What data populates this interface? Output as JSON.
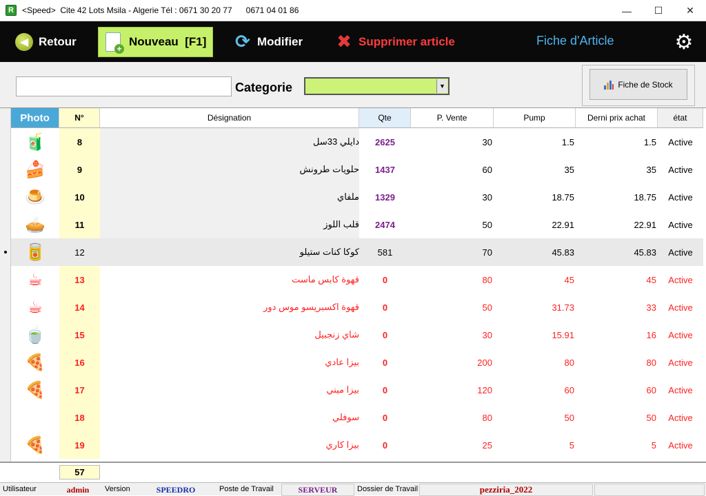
{
  "window": {
    "title": "<Speed>  Cite 42 Lots Msila - Algerie Tél : 0671 30 20 77      0671 04 01 86",
    "minimize": "—",
    "maximize": "☐",
    "close": "✕"
  },
  "toolbar": {
    "retour_label": "Retour",
    "nouveau_label": "Nouveau  [F1]",
    "modifier_label": "Modifier",
    "supprimer_label": "Supprimer article",
    "fiche_title": "Fiche d'Article",
    "colors": {
      "background": "#0a0a0a",
      "nouveau_bg": "#c6f06a",
      "fiche_title": "#4fb3ee",
      "supprimer": "#ff3c3c"
    }
  },
  "filter": {
    "search_value": "",
    "categorie_label": "Categorie",
    "categorie_value": "",
    "fiche_stock_label": "Fiche de Stock"
  },
  "grid": {
    "columns": [
      "Photo",
      "N°",
      "Désignation",
      "Qte",
      "P. Vente",
      "Pump",
      "Derni prix achat",
      "état"
    ],
    "rows": [
      {
        "photo": "juice-box-icon",
        "num": "8",
        "designation": "دايلي 33سل",
        "qte": "2625",
        "vente": "30",
        "pump": "1.5",
        "achat": "1.5",
        "etat": "Active"
      },
      {
        "photo": "cake-slice-icon",
        "num": "9",
        "designation": "حلويات طرونش",
        "qte": "1437",
        "vente": "60",
        "pump": "35",
        "achat": "35",
        "etat": "Active"
      },
      {
        "photo": "mille-feuille-icon",
        "num": "10",
        "designation": "ملفاي",
        "qte": "1329",
        "vente": "30",
        "pump": "18.75",
        "achat": "18.75",
        "etat": "Active"
      },
      {
        "photo": "almond-cake-icon",
        "num": "11",
        "designation": "قلب اللوز",
        "qte": "2474",
        "vente": "50",
        "pump": "22.91",
        "achat": "22.91",
        "etat": "Active"
      },
      {
        "photo": "cola-can-icon",
        "num": "12",
        "designation": "كوكا كنات ستيلو",
        "qte": "581",
        "vente": "70",
        "pump": "45.83",
        "achat": "45.83",
        "etat": "Active"
      },
      {
        "photo": "coffee-cup-icon",
        "num": "13",
        "designation": "قهوة كابس ماست",
        "qte": "0",
        "vente": "80",
        "pump": "45",
        "achat": "45",
        "etat": "Active"
      },
      {
        "photo": "espresso-cup-icon",
        "num": "14",
        "designation": "قهوة اكسبريسو موس دور",
        "qte": "0",
        "vente": "50",
        "pump": "31.73",
        "achat": "33",
        "etat": "Active"
      },
      {
        "photo": "tea-glass-icon",
        "num": "15",
        "designation": "شاي زنجبيل",
        "qte": "0",
        "vente": "30",
        "pump": "15.91",
        "achat": "16",
        "etat": "Active"
      },
      {
        "photo": "pizza-icon",
        "num": "16",
        "designation": "بيزا عادي",
        "qte": "0",
        "vente": "200",
        "pump": "80",
        "achat": "80",
        "etat": "Active"
      },
      {
        "photo": "pizza-icon",
        "num": "17",
        "designation": "بيزا ميني",
        "qte": "0",
        "vente": "120",
        "pump": "60",
        "achat": "60",
        "etat": "Active"
      },
      {
        "photo": "",
        "num": "18",
        "designation": "سوفلي",
        "qte": "0",
        "vente": "80",
        "pump": "50",
        "achat": "50",
        "etat": "Active"
      },
      {
        "photo": "pizza-slice-icon",
        "num": "19",
        "designation": "بيزا كاري",
        "qte": "0",
        "vente": "25",
        "pump": "5",
        "achat": "5",
        "etat": "Active"
      }
    ],
    "selected_row_index": 4,
    "total": "57",
    "colors": {
      "photo_header": "#4aa8d8",
      "num_column": "#fffccd",
      "qte_header": "#e0eefa",
      "qte_text": "#7a1f8c",
      "zero_stock": "#ff2020"
    }
  },
  "status": {
    "utilisateur_label": "Utilisateur",
    "utilisateur_value": "admin",
    "version_label": "Version",
    "version_value": "SPEEDRO",
    "poste_label": "Poste de Travail",
    "poste_value": "SERVEUR",
    "dossier_label": "Dossier de Travail",
    "dossier_value": "pezziria_2022"
  }
}
